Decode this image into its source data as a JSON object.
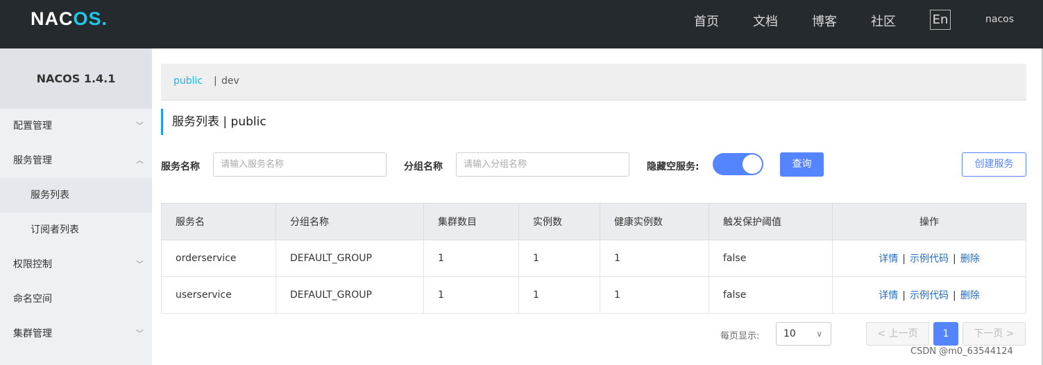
{
  "header": {
    "logo_text_1": "NAC",
    "logo_text_2": "OS",
    "logo_dot": ".",
    "nav": [
      "首页",
      "文档",
      "博客",
      "社区"
    ],
    "lang": "En",
    "user": "nacos"
  },
  "sidebar": {
    "title": "NACOS 1.4.1",
    "items": [
      {
        "label": "配置管理",
        "chevron": "﹀"
      },
      {
        "label": "服务管理",
        "chevron": "︿"
      },
      {
        "label": "服务列表"
      },
      {
        "label": "订阅者列表"
      },
      {
        "label": "权限控制",
        "chevron": "﹀"
      },
      {
        "label": "命名空间"
      },
      {
        "label": "集群管理",
        "chevron": "﹀"
      }
    ]
  },
  "namespaces": {
    "active": "public",
    "separator": "|",
    "other": "dev"
  },
  "page": {
    "title": "服务列表  |  public"
  },
  "filters": {
    "service_name_label": "服务名称",
    "service_name_placeholder": "请输入服务名称",
    "group_name_label": "分组名称",
    "group_name_placeholder": "请输入分组名称",
    "hide_empty_label": "隐藏空服务:",
    "hide_empty_on": true,
    "query_button": "查询",
    "create_button": "创建服务"
  },
  "table": {
    "headers": [
      "服务名",
      "分组名称",
      "集群数目",
      "实例数",
      "健康实例数",
      "触发保护阈值",
      "操作"
    ],
    "rows": [
      {
        "name": "orderservice",
        "group": "DEFAULT_GROUP",
        "clusters": "1",
        "instances": "1",
        "healthy": "1",
        "threshold": "false"
      },
      {
        "name": "userservice",
        "group": "DEFAULT_GROUP",
        "clusters": "1",
        "instances": "1",
        "healthy": "1",
        "threshold": "false"
      }
    ],
    "actions": {
      "detail": "详情",
      "sample": "示例代码",
      "delete": "删除",
      "sep": "|"
    }
  },
  "pagination": {
    "page_size_label": "每页显示:",
    "page_size": "10",
    "prev": "上一页",
    "next": "下一页",
    "current": "1"
  },
  "watermark": "CSDN @m0_63544124",
  "colors": {
    "accent": "#5584ff",
    "topbar": "#252a2f",
    "link": "#1a6ec8",
    "ns_active": "#1db3dd"
  }
}
